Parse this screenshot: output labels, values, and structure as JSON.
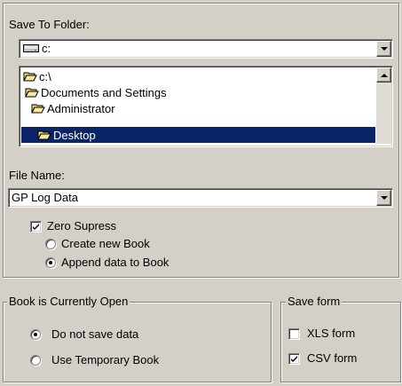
{
  "save_to_folder": {
    "label": "Save To Folder:",
    "drive_value": "c:",
    "tree": [
      {
        "label": "c:\\",
        "selected": false
      },
      {
        "label": "Documents and Settings",
        "selected": false
      },
      {
        "label": "Administrator",
        "selected": false
      },
      {
        "label": "Desktop",
        "selected": true
      }
    ]
  },
  "file_name": {
    "label": "File Name:",
    "value": "GP Log Data"
  },
  "options": {
    "zero_supress": {
      "label": "Zero Supress",
      "checked": true
    },
    "create_new_book": {
      "label": "Create new Book",
      "selected": false
    },
    "append_data": {
      "label": "Append data to Book",
      "selected": true
    }
  },
  "book_open": {
    "legend": "Book is Currently Open",
    "do_not_save": {
      "label": "Do not save data",
      "selected": true
    },
    "use_temporary": {
      "label": "Use Temporary Book",
      "selected": false
    }
  },
  "save_form": {
    "legend": "Save form",
    "xls": {
      "label": "XLS form",
      "checked": false
    },
    "csv": {
      "label": "CSV form",
      "checked": true
    }
  },
  "colors": {
    "face": "#d4d0c8",
    "selection": "#0a246a",
    "folder": "#f0d878"
  }
}
